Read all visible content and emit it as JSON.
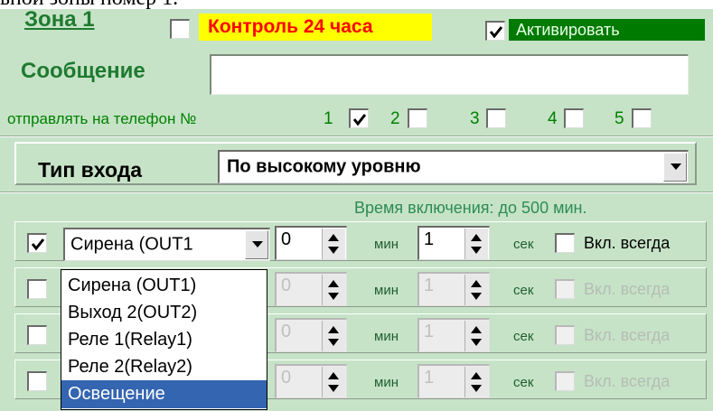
{
  "top_text": "ьной зоны номер 1.",
  "zone": {
    "title": "Зона 1",
    "control_label": "Контроль 24 часа",
    "control_checked": false,
    "activate_label": "Активировать",
    "activate_checked": true
  },
  "message": {
    "label": "Сообщение",
    "value": ""
  },
  "send_to_phone": {
    "label": "отправлять на телефон №",
    "phones": [
      {
        "number": "1",
        "checked": true
      },
      {
        "number": "2",
        "checked": false
      },
      {
        "number": "3",
        "checked": false
      },
      {
        "number": "4",
        "checked": false
      },
      {
        "number": "5",
        "checked": false
      }
    ]
  },
  "input_type": {
    "label": "Тип входа",
    "selected": "По высокому уровню"
  },
  "time_caption": "Время включения: до 500 мин.",
  "outputs": [
    {
      "enabled": true,
      "output": "Сирена (OUT1",
      "minutes": "0",
      "min_label": "мин",
      "seconds": "1",
      "sec_label": "сек",
      "always_label": "Вкл. всегда",
      "always_checked": false
    },
    {
      "enabled": false,
      "minutes": "0",
      "min_label": "мин",
      "seconds": "1",
      "sec_label": "сек",
      "always_label": "Вкл. всегда",
      "always_checked": false
    },
    {
      "enabled": false,
      "minutes": "0",
      "min_label": "мин",
      "seconds": "1",
      "sec_label": "сек",
      "always_label": "Вкл. всегда",
      "always_checked": false
    },
    {
      "enabled": false,
      "minutes": "0",
      "min_label": "мин",
      "seconds": "1",
      "sec_label": "сек",
      "always_label": "Вкл. всегда",
      "always_checked": false
    }
  ],
  "output_dropdown": {
    "options": [
      "Сирена (OUT1)",
      "Выход 2(OUT2)",
      "Реле 1(Relay1)",
      "Реле 2(Relay2)",
      "Освещение"
    ],
    "highlighted": "Освещение"
  },
  "colors": {
    "panel_bg": "#c6e3c7",
    "zone_green": "#1f7a2f",
    "control_bg": "#ffff00",
    "control_text": "#ff0000",
    "activate_bg": "#007a00",
    "selection": "#3465b0"
  },
  "icons": [
    "checkmark-icon",
    "dropdown-arrow-icon",
    "spin-up-icon",
    "spin-down-icon"
  ]
}
